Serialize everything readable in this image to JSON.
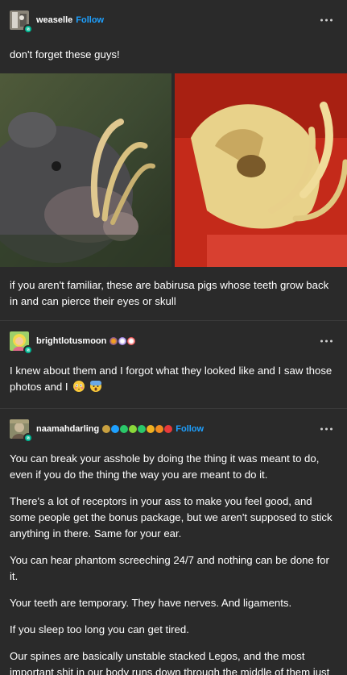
{
  "posts": [
    {
      "username": "weaselle",
      "follow_label": "Follow",
      "caption": "don't forget these guys!",
      "body": "if you aren't familiar, these are babirusa pigs whose teeth grow back in and can pierce their eyes or skull",
      "images": [
        "babirusa-photo",
        "babirusa-skull-photo"
      ]
    },
    {
      "username": "brightlotusmoon",
      "body": "I knew about them and I forgot what they looked like and I saw those photos and I"
    },
    {
      "username": "naamahdarling",
      "follow_label": "Follow",
      "paragraphs": [
        "You can break your asshole by doing the thing it was meant to do, even if you do the thing the way you are meant to do it.",
        "There's a lot of receptors in your ass to make you feel good, and some people get the bonus package, but we aren't supposed to stick anything in there. Same for your ear.",
        "You can hear phantom screeching 24/7 and nothing can be done for it.",
        "Your teeth are temporary. They have nerves. And ligaments.",
        "If you sleep too long you can get tired.",
        "Our spines are basically unstable stacked Legos, and the most important shit in our body runs down through the middle of them just as if nothing is wrong with that."
      ]
    }
  ],
  "colors": {
    "background": "#2a2a2a",
    "follow": "#1ea0ff",
    "reblog": "#00b894"
  },
  "icons": [
    "more-options-icon",
    "reblog-icon",
    "flushed-emoji",
    "scream-emoji"
  ]
}
